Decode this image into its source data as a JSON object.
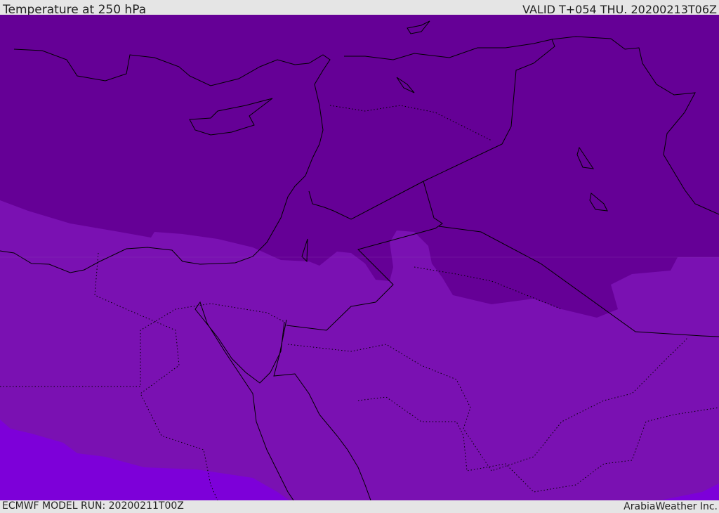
{
  "header": {
    "title": "Temperature at 250 hPa",
    "valid": "VALID T+054 THU. 20200213T06Z"
  },
  "footer": {
    "model_run": "ECMWF MODEL RUN: 20200211T00Z",
    "credit": "ArabiaWeather Inc."
  },
  "colors": {
    "cold_band": "#650096",
    "mid_band": "#7a11b2",
    "warm_band": "#7d00d9",
    "bar": "#e5e5e5"
  }
}
